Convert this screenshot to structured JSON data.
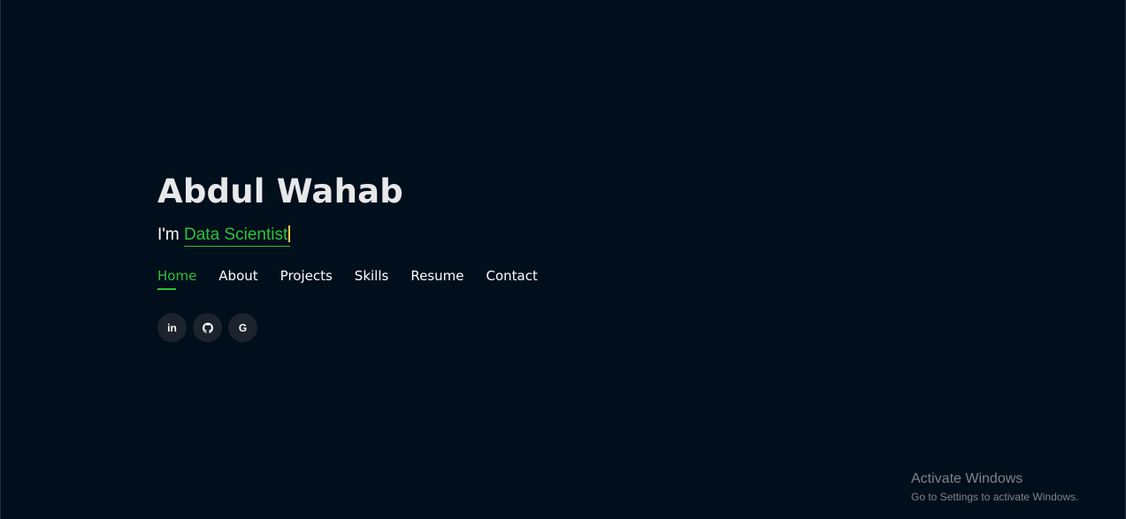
{
  "hero": {
    "name": "Abdul Wahab",
    "intro_prefix": "I'm ",
    "role": "Data Scientist"
  },
  "nav": {
    "items": [
      {
        "label": "Home",
        "active": true
      },
      {
        "label": "About",
        "active": false
      },
      {
        "label": "Projects",
        "active": false
      },
      {
        "label": "Skills",
        "active": false
      },
      {
        "label": "Resume",
        "active": false
      },
      {
        "label": "Contact",
        "active": false
      }
    ]
  },
  "social": {
    "linkedin_label": "in",
    "github_icon": "github-icon",
    "google_label": "G"
  },
  "watermark": {
    "title": "Activate Windows",
    "subtitle": "Go to Settings to activate Windows."
  },
  "colors": {
    "background": "#010e1b",
    "accent": "#2ec23a",
    "cursor": "#f2c94c",
    "text": "#ffffff",
    "social_bg": "#1d232c"
  }
}
